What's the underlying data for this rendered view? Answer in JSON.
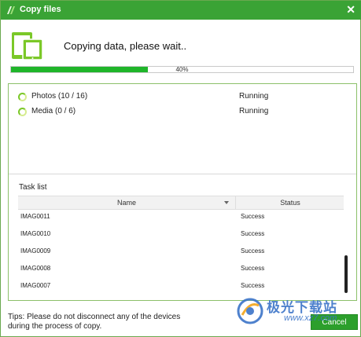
{
  "window": {
    "title": "Copy files",
    "close_glyph": "✕"
  },
  "header": {
    "heading": "Copying data, please wait..",
    "icon": "devices-icon"
  },
  "progress": {
    "value_percent": 40,
    "label": "40%"
  },
  "copy_items": [
    {
      "name": "Photos (10 / 16)",
      "status": "Running"
    },
    {
      "name": "Media (0 / 6)",
      "status": "Running"
    }
  ],
  "task_list": {
    "label": "Task list",
    "columns": {
      "name": "Name",
      "status": "Status"
    },
    "rows": [
      {
        "name": "IMAG0011",
        "status": "Success"
      },
      {
        "name": "IMAG0010",
        "status": "Success"
      },
      {
        "name": "IMAG0009",
        "status": "Success"
      },
      {
        "name": "IMAG0008",
        "status": "Success"
      },
      {
        "name": "IMAG0007",
        "status": "Success"
      }
    ]
  },
  "footer": {
    "tips": "Tips: Please do not disconnect any of the devices during the process of copy.",
    "cancel_label": "Cancel"
  },
  "watermark": {
    "text": "极光下载站",
    "url": "www.xz7.com"
  },
  "colors": {
    "accent": "#3aa335",
    "progress_fill": "#1fb52a",
    "button": "#2c9f2c"
  }
}
